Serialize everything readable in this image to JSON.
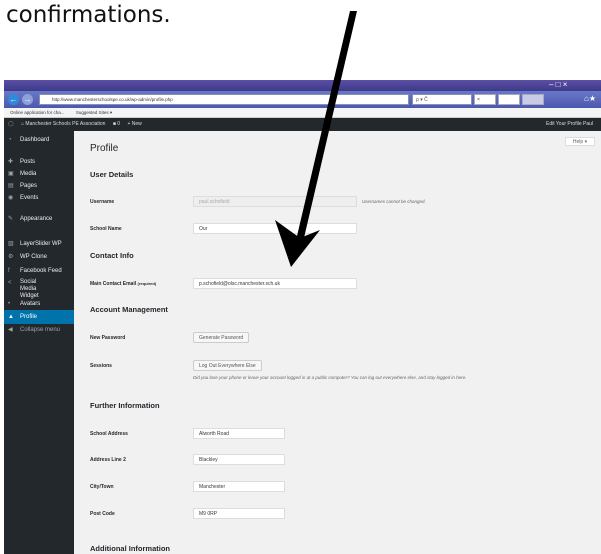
{
  "caption": "confirmations.",
  "browser": {
    "url": "http://www.manchesterschoolspe.co.uk/wp-admin/profile.php",
    "search_placeholder": "ρ ▾ Č",
    "tab_label": "×",
    "window_controls": "–  □  ×"
  },
  "bookmarks": {
    "item1": "Online application for cha...",
    "item2": "Suggested Sites ▾"
  },
  "adminbar": {
    "site_name": "Manchester Schools PE Association",
    "comments_count": "0",
    "new_label": "New",
    "user_greeting": "Edit Your Profile Paul"
  },
  "sidebar": {
    "items": [
      {
        "label": "Dashboard",
        "icon": "dashboard-icon",
        "glyph": "◔"
      },
      {
        "label": "Posts",
        "icon": "pin-icon",
        "glyph": "✚"
      },
      {
        "label": "Media",
        "icon": "media-icon",
        "glyph": "▣"
      },
      {
        "label": "Pages",
        "icon": "page-icon",
        "glyph": "▤"
      },
      {
        "label": "Events",
        "icon": "events-icon",
        "glyph": "◉"
      },
      {
        "label": "Appearance",
        "icon": "brush-icon",
        "glyph": "✎"
      },
      {
        "label": "LayerSlider WP",
        "icon": "layers-icon",
        "glyph": "▧"
      },
      {
        "label": "WP Clone",
        "icon": "gear-icon",
        "glyph": "⚙"
      },
      {
        "label": "Facebook Feed",
        "icon": "facebook-icon",
        "glyph": "f"
      },
      {
        "label": "Social Media Widget",
        "icon": "share-icon",
        "glyph": "<"
      },
      {
        "label": "Avatars",
        "icon": "bullet-icon",
        "glyph": "•"
      },
      {
        "label": "Profile",
        "icon": "user-icon",
        "glyph": "▲"
      },
      {
        "label": "Collapse menu",
        "icon": "collapse-icon",
        "glyph": "◀"
      }
    ]
  },
  "page": {
    "title": "Profile",
    "help_label": "Help ▾"
  },
  "sections": {
    "user_details": "User Details",
    "contact_info": "Contact Info",
    "account_management": "Account Management",
    "further_information": "Further Information",
    "additional_information": "Additional Information"
  },
  "fields": {
    "username_label": "Username",
    "username_value": "paul.schofield",
    "username_note": "Usernames cannot be changed.",
    "school_name_label": "School Name",
    "school_name_value": "Our",
    "email_label": "Main Contact Email",
    "email_required": "(required)",
    "email_value": "p.schofield@olsc.manchester.sch.uk",
    "new_password_label": "New Password",
    "generate_password_button": "Generate Password",
    "sessions_label": "Sessions",
    "logout_button": "Log Out Everywhere Else",
    "sessions_note": "Did you lose your phone or leave your account logged in at a public computer? You can log out everywhere else, and stay logged in here.",
    "school_address_label": "School Address",
    "school_address_value": "Alworth Road",
    "address2_label": "Address Line 2",
    "address2_value": "Blackley",
    "city_label": "City/Town",
    "city_value": "Manchester",
    "postcode_label": "Post Code",
    "postcode_value": "M9 0RP"
  }
}
